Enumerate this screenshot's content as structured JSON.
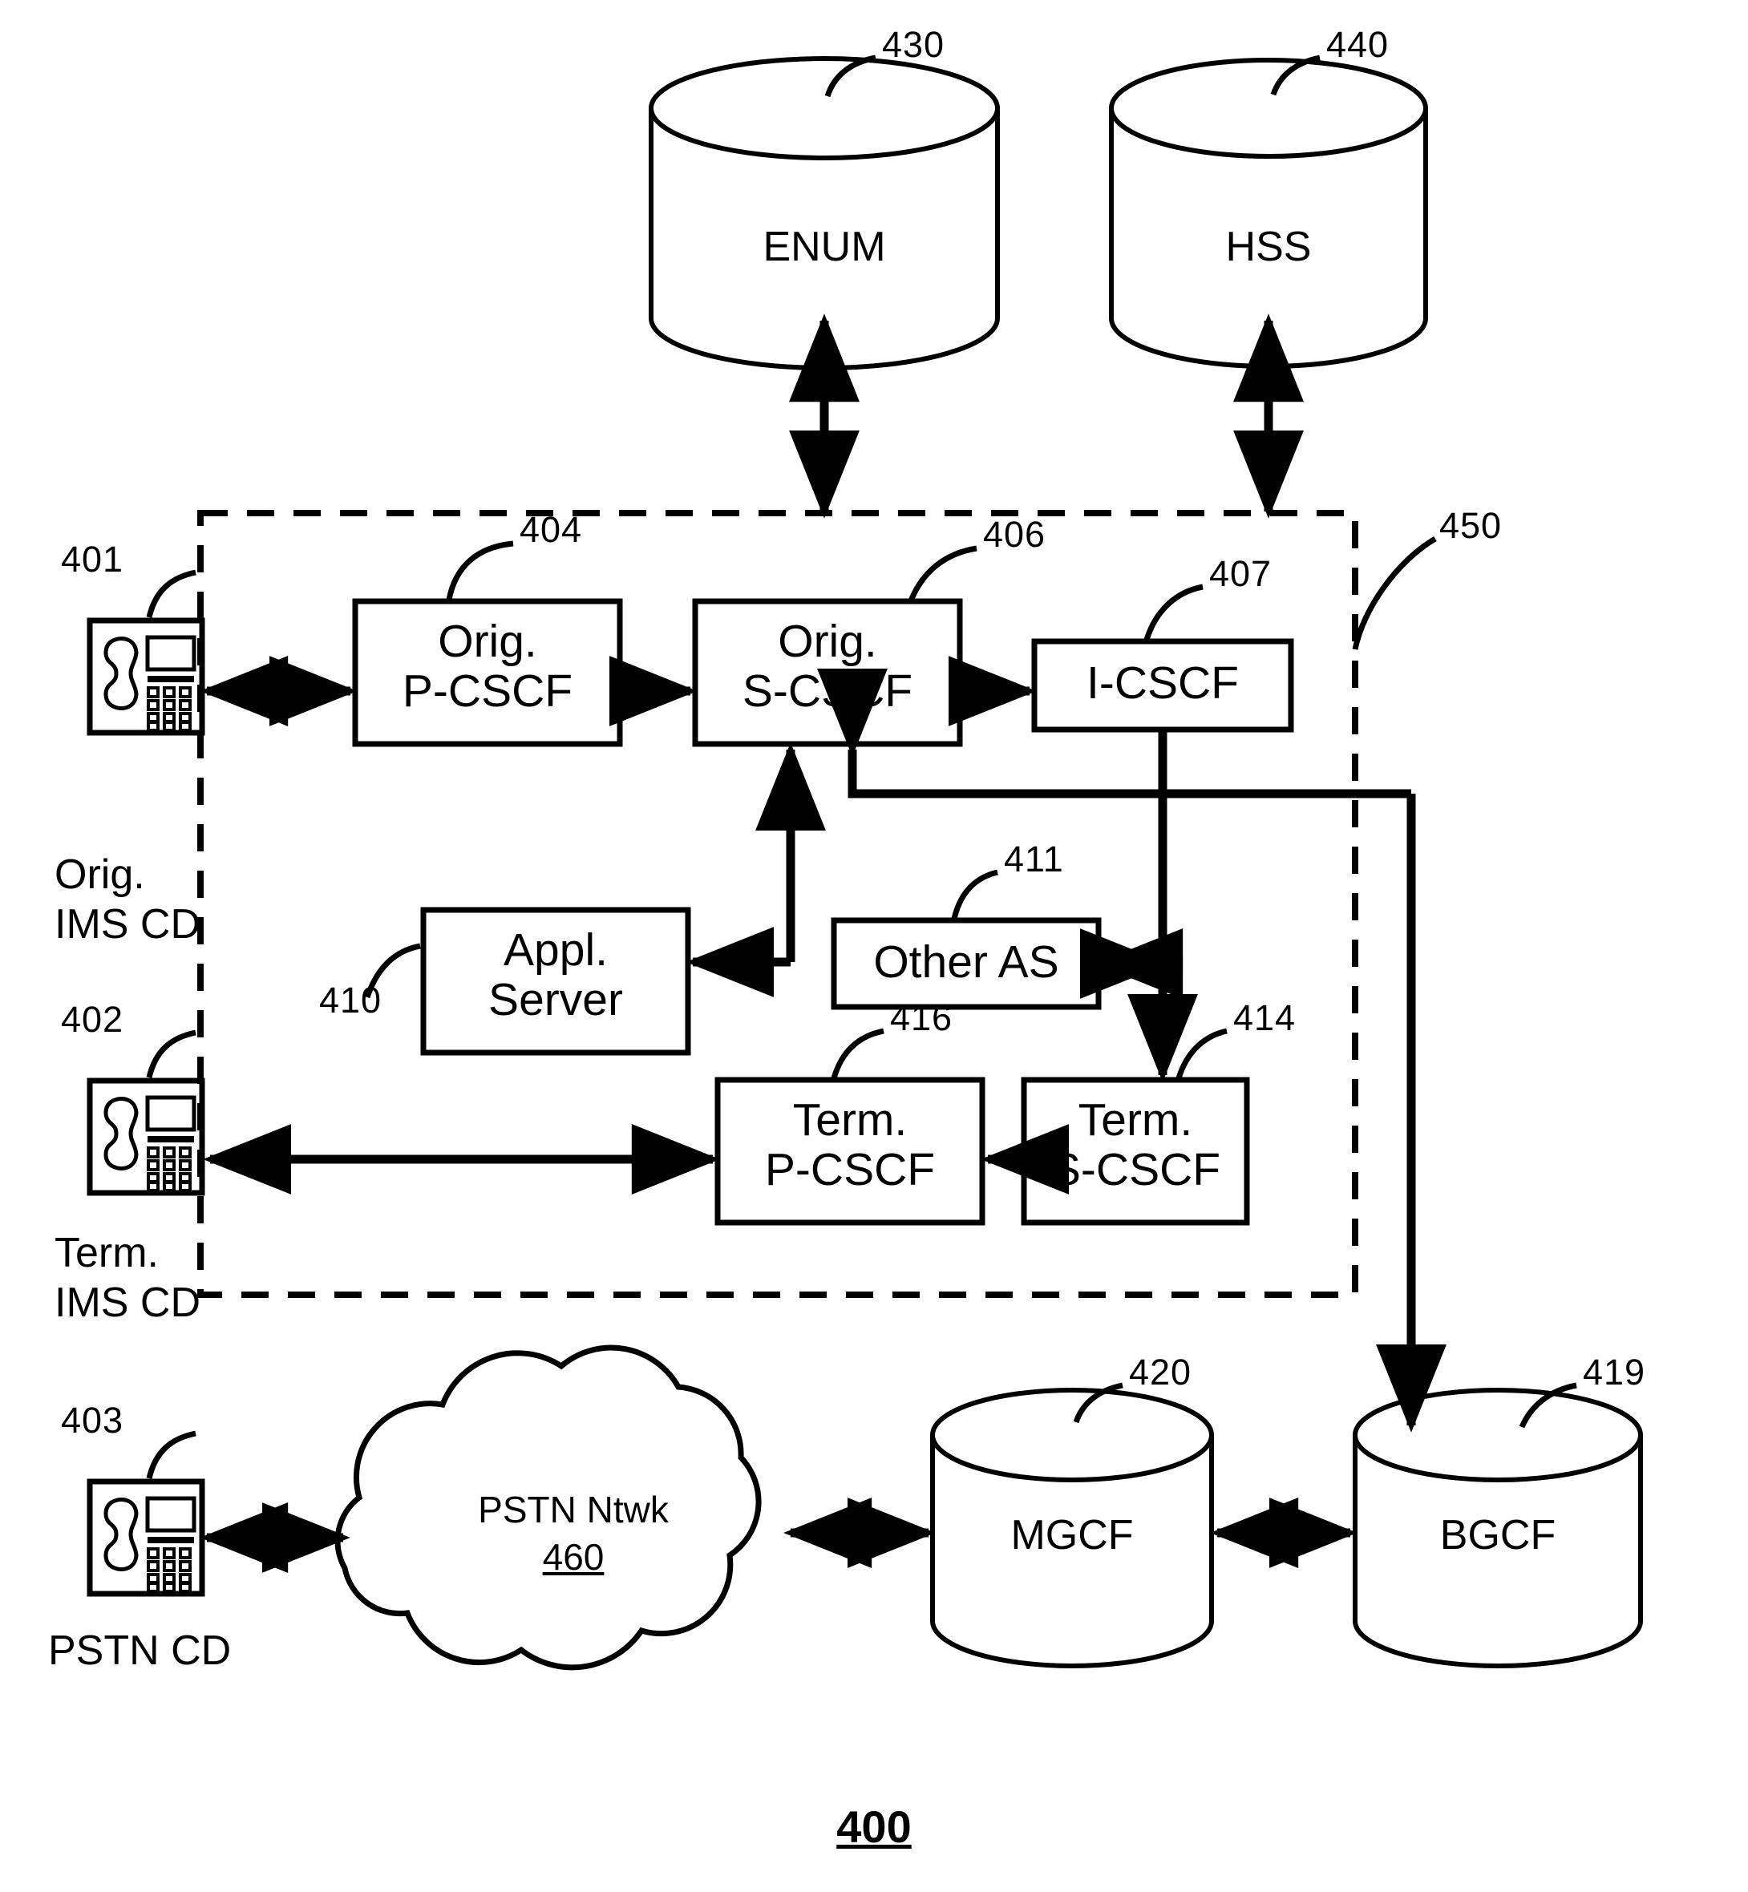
{
  "figure": {
    "number": "400",
    "caption_underlined": true
  },
  "datastores": [
    {
      "id": "enum",
      "label": "ENUM",
      "ref": "430"
    },
    {
      "id": "hss",
      "label": "HSS",
      "ref": "440"
    },
    {
      "id": "mgcf",
      "label": "MGCF",
      "ref": "420"
    },
    {
      "id": "bgcf",
      "label": "BGCF",
      "ref": "419"
    }
  ],
  "boxes": [
    {
      "id": "orig-p-cscf",
      "line1": "Orig.",
      "line2": "P-CSCF",
      "ref": "404"
    },
    {
      "id": "orig-s-cscf",
      "line1": "Orig.",
      "line2": "S-CSCF",
      "ref": "406"
    },
    {
      "id": "i-cscf",
      "line1": "I-CSCF",
      "line2": "",
      "ref": "407"
    },
    {
      "id": "appl-server",
      "line1": "Appl.",
      "line2": "Server",
      "ref": "410"
    },
    {
      "id": "other-as",
      "line1": "Other AS",
      "line2": "",
      "ref": "411"
    },
    {
      "id": "term-p-cscf",
      "line1": "Term.",
      "line2": "P-CSCF",
      "ref": "416"
    },
    {
      "id": "term-s-cscf",
      "line1": "Term.",
      "line2": "S-CSCF",
      "ref": "414"
    }
  ],
  "devices": [
    {
      "id": "orig-ims-cd",
      "ref": "401",
      "caption_line1": "Orig.",
      "caption_line2": "IMS CD",
      "icon": "desk-phone-icon"
    },
    {
      "id": "term-ims-cd",
      "ref": "402",
      "caption_line1": "Term.",
      "caption_line2": "IMS CD",
      "icon": "desk-phone-icon"
    },
    {
      "id": "pstn-cd",
      "ref": "403",
      "caption_line1": "PSTN CD",
      "caption_line2": "",
      "icon": "desk-phone-icon"
    }
  ],
  "cloud": {
    "id": "pstn-network",
    "label": "PSTN Ntwk",
    "ref": "460"
  },
  "ims_network": {
    "id": "ims-core-boundary",
    "ref": "450",
    "style": "dashed"
  },
  "colors": {
    "ink": "#000000",
    "paper": "#ffffff"
  },
  "connections": [
    {
      "from": "orig-s-cscf",
      "to": "enum",
      "arrow": "both"
    },
    {
      "from": "i-cscf",
      "to": "hss",
      "arrow": "both"
    },
    {
      "from": "orig-ims-cd",
      "to": "orig-p-cscf",
      "arrow": "both"
    },
    {
      "from": "orig-p-cscf",
      "to": "orig-s-cscf",
      "arrow": "forward"
    },
    {
      "from": "orig-s-cscf",
      "to": "i-cscf",
      "arrow": "forward"
    },
    {
      "from": "orig-s-cscf",
      "to": "appl-server",
      "arrow": "forward"
    },
    {
      "from": "other-as",
      "to": "i-cscf-bus",
      "arrow": "both"
    },
    {
      "from": "i-cscf",
      "to": "term-s-cscf",
      "arrow": "forward"
    },
    {
      "from": "term-s-cscf",
      "to": "term-p-cscf",
      "arrow": "forward"
    },
    {
      "from": "term-p-cscf",
      "to": "term-ims-cd",
      "arrow": "both"
    },
    {
      "from": "i-cscf-bus",
      "to": "bgcf",
      "arrow": "forward"
    },
    {
      "from": "pstn-cd",
      "to": "pstn-network",
      "arrow": "both"
    },
    {
      "from": "pstn-network",
      "to": "mgcf",
      "arrow": "both"
    },
    {
      "from": "mgcf",
      "to": "bgcf",
      "arrow": "both"
    }
  ]
}
